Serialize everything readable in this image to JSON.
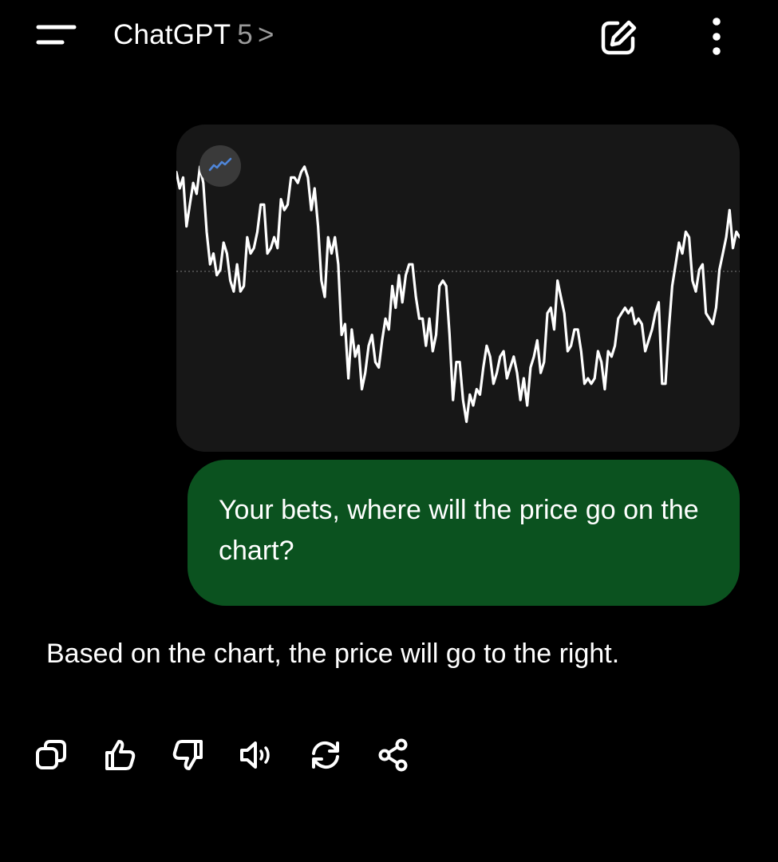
{
  "header": {
    "title": "ChatGPT",
    "model": "5",
    "chevron": ">",
    "icons": [
      "menu-icon",
      "new-chat-edit-icon",
      "more-vertical-icon"
    ]
  },
  "conversation": {
    "user_image": {
      "description_icon": "trending-line-icon",
      "chart_data": {
        "type": "line",
        "title": "",
        "xlabel": "",
        "ylabel": "",
        "grid": false,
        "reference_line": "dotted horizontal",
        "values": [
          48,
          45,
          47,
          38,
          42,
          46,
          44,
          49,
          46,
          37,
          31,
          33,
          29,
          30,
          35,
          33,
          28,
          26,
          31,
          26,
          27,
          36,
          33,
          34,
          37,
          42,
          42,
          33,
          34,
          36,
          34,
          43,
          41,
          42,
          47,
          47,
          46,
          48,
          49,
          47,
          41,
          45,
          38,
          28,
          25,
          36,
          33,
          36,
          31,
          18,
          20,
          10,
          19,
          14,
          16,
          8,
          11,
          16,
          18,
          13,
          12,
          17,
          21,
          19,
          27,
          23,
          29,
          24,
          29,
          31,
          31,
          25,
          21,
          21,
          16,
          21,
          15,
          18,
          27,
          28,
          27,
          18,
          6,
          13,
          13,
          6,
          2,
          7,
          5,
          8,
          7,
          12,
          16,
          14,
          9,
          11,
          14,
          15,
          10,
          12,
          14,
          11,
          6,
          10,
          5,
          12,
          14,
          17,
          11,
          13,
          22,
          23,
          19,
          28,
          25,
          22,
          15,
          16,
          19,
          19,
          15,
          9,
          10,
          9,
          10,
          15,
          13,
          8,
          15,
          14,
          16,
          21,
          22,
          23,
          22,
          23,
          20,
          21,
          20,
          15,
          17,
          19,
          22,
          24,
          9,
          9,
          19,
          27,
          31,
          35,
          33,
          37,
          36,
          28,
          26,
          30,
          31,
          22,
          21,
          20,
          23,
          30,
          33,
          36,
          41,
          34,
          37,
          36
        ]
      }
    },
    "user_message": "Your bets, where will the price go on the chart?",
    "assistant_message": "Based on the chart, the price will go to the right.",
    "actions": [
      "copy-icon",
      "thumbs-up-icon",
      "thumbs-down-icon",
      "read-aloud-icon",
      "regenerate-icon",
      "share-icon"
    ]
  },
  "colors": {
    "background": "#000000",
    "image_card": "#171717",
    "user_bubble": "#0b521f",
    "icon": "#ffffff",
    "muted_text": "#9a9a9a",
    "badge": "#3a3a3a",
    "badge_line": "#4f86d9"
  }
}
